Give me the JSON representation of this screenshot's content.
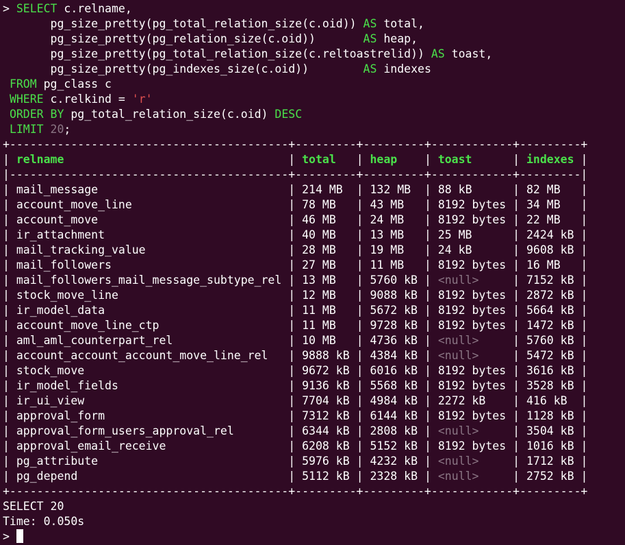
{
  "terminal": {
    "prompt_char": ">",
    "query": {
      "select_kw": "SELECT",
      "select_expr": "c.relname,",
      "lines": [
        {
          "fn": "pg_size_pretty(pg_total_relation_size(c.oid))",
          "pad": " ",
          "as": "AS",
          "alias": "total,"
        },
        {
          "fn": "pg_size_pretty(pg_relation_size(c.oid))",
          "pad": "       ",
          "as": "AS",
          "alias": "heap,"
        },
        {
          "fn": "pg_size_pretty(pg_total_relation_size(c.reltoastrelid))",
          "pad": " ",
          "as": "AS",
          "alias": "toast,"
        },
        {
          "fn": "pg_size_pretty(pg_indexes_size(c.oid))",
          "pad": "        ",
          "as": "AS",
          "alias": "indexes"
        }
      ],
      "from_kw": "FROM",
      "from_expr": "pg_class c",
      "where_kw": "WHERE",
      "where_expr": "c.relkind =",
      "where_value": "'r'",
      "order_kw": "ORDER BY",
      "order_expr": "pg_total_relation_size(c.oid)",
      "order_dir": "DESC",
      "limit_kw": "LIMIT",
      "limit_value": "20",
      "limit_end": ";"
    },
    "table": {
      "columns": [
        "relname",
        "total",
        "heap",
        "toast",
        "indexes"
      ],
      "rows": [
        [
          "mail_message",
          "214 MB",
          "132 MB",
          "88 kB",
          "82 MB"
        ],
        [
          "account_move_line",
          "78 MB",
          "43 MB",
          "8192 bytes",
          "34 MB"
        ],
        [
          "account_move",
          "46 MB",
          "24 MB",
          "8192 bytes",
          "22 MB"
        ],
        [
          "ir_attachment",
          "40 MB",
          "13 MB",
          "25 MB",
          "2424 kB"
        ],
        [
          "mail_tracking_value",
          "28 MB",
          "19 MB",
          "24 kB",
          "9608 kB"
        ],
        [
          "mail_followers",
          "27 MB",
          "11 MB",
          "8192 bytes",
          "16 MB"
        ],
        [
          "mail_followers_mail_message_subtype_rel",
          "13 MB",
          "5760 kB",
          "<null>",
          "7152 kB"
        ],
        [
          "stock_move_line",
          "12 MB",
          "9088 kB",
          "8192 bytes",
          "2872 kB"
        ],
        [
          "ir_model_data",
          "11 MB",
          "5672 kB",
          "8192 bytes",
          "5664 kB"
        ],
        [
          "account_move_line_ctp",
          "11 MB",
          "9728 kB",
          "8192 bytes",
          "1472 kB"
        ],
        [
          "aml_aml_counterpart_rel",
          "10 MB",
          "4736 kB",
          "<null>",
          "5760 kB"
        ],
        [
          "account_account_account_move_line_rel",
          "9888 kB",
          "4384 kB",
          "<null>",
          "5472 kB"
        ],
        [
          "stock_move",
          "9672 kB",
          "6016 kB",
          "8192 bytes",
          "3616 kB"
        ],
        [
          "ir_model_fields",
          "9136 kB",
          "5568 kB",
          "8192 bytes",
          "3528 kB"
        ],
        [
          "ir_ui_view",
          "7704 kB",
          "4984 kB",
          "2272 kB",
          "416 kB"
        ],
        [
          "approval_form",
          "7312 kB",
          "6144 kB",
          "8192 bytes",
          "1128 kB"
        ],
        [
          "approval_form_users_approval_rel",
          "6344 kB",
          "2808 kB",
          "<null>",
          "3504 kB"
        ],
        [
          "approval_email_receive",
          "6208 kB",
          "5152 kB",
          "8192 bytes",
          "1016 kB"
        ],
        [
          "pg_attribute",
          "5976 kB",
          "4232 kB",
          "<null>",
          "1712 kB"
        ],
        [
          "pg_depend",
          "5112 kB",
          "2328 kB",
          "<null>",
          "2752 kB"
        ]
      ]
    },
    "status": "SELECT 20",
    "timing": "Time: 0.050s",
    "null_value": "<null>",
    "colors": {
      "background": "#300a24",
      "keyword": "#4ae04a",
      "string": "#e05050",
      "null": "#8a7584"
    }
  }
}
